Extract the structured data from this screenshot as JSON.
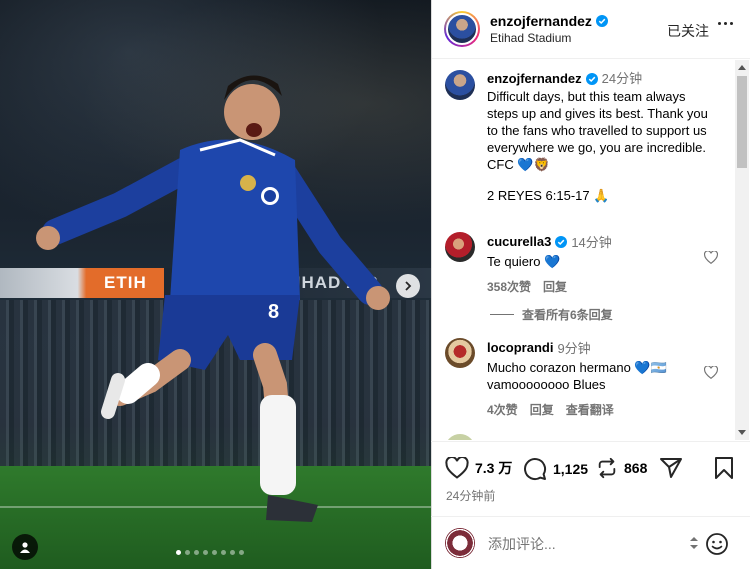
{
  "post": {
    "dots_total": 8,
    "dots_active_index": 0
  },
  "header": {
    "username": "enzojfernandez",
    "location": "Etihad Stadium",
    "follow_state": "已关注"
  },
  "caption": {
    "username": "enzojfernandez",
    "time": "24分钟",
    "text": "Difficult days, but this team always steps up and gives its best. Thank you to the fans who travelled to support us everywhere we go, you are incredible. CFC 💙🦁",
    "text2": "2 REYES 6:15-17 🙏"
  },
  "comments": [
    {
      "username": "cucurella3",
      "time": "14分钟",
      "text": "Te quiero 💙",
      "likes": "358次赞",
      "reply_label": "回复",
      "view_replies": "查看所有6条回复"
    },
    {
      "username": "locoprandi",
      "time": "9分钟",
      "text": "Mucho corazon hermano 💙🇦🇷\nvamoooooooo Blues",
      "likes": "4次赞",
      "reply_label": "回复",
      "translate_label": "查看翻译"
    }
  ],
  "actions": {
    "likes": "7.3 万",
    "comments": "1,125",
    "reposts": "868",
    "posted_ago": "24分钟前"
  },
  "composer": {
    "placeholder": "添加评论..."
  },
  "colors": {
    "verified": "#0095f6",
    "chelsea_blue": "#1a3fa0"
  },
  "icons": {
    "next": "chevron-right-icon",
    "user_tag": "user-tag-icon",
    "like": "heart-icon",
    "comment": "comment-icon",
    "repost": "repost-icon",
    "share": "send-icon",
    "save": "bookmark-icon",
    "emoji": "emoji-icon"
  }
}
